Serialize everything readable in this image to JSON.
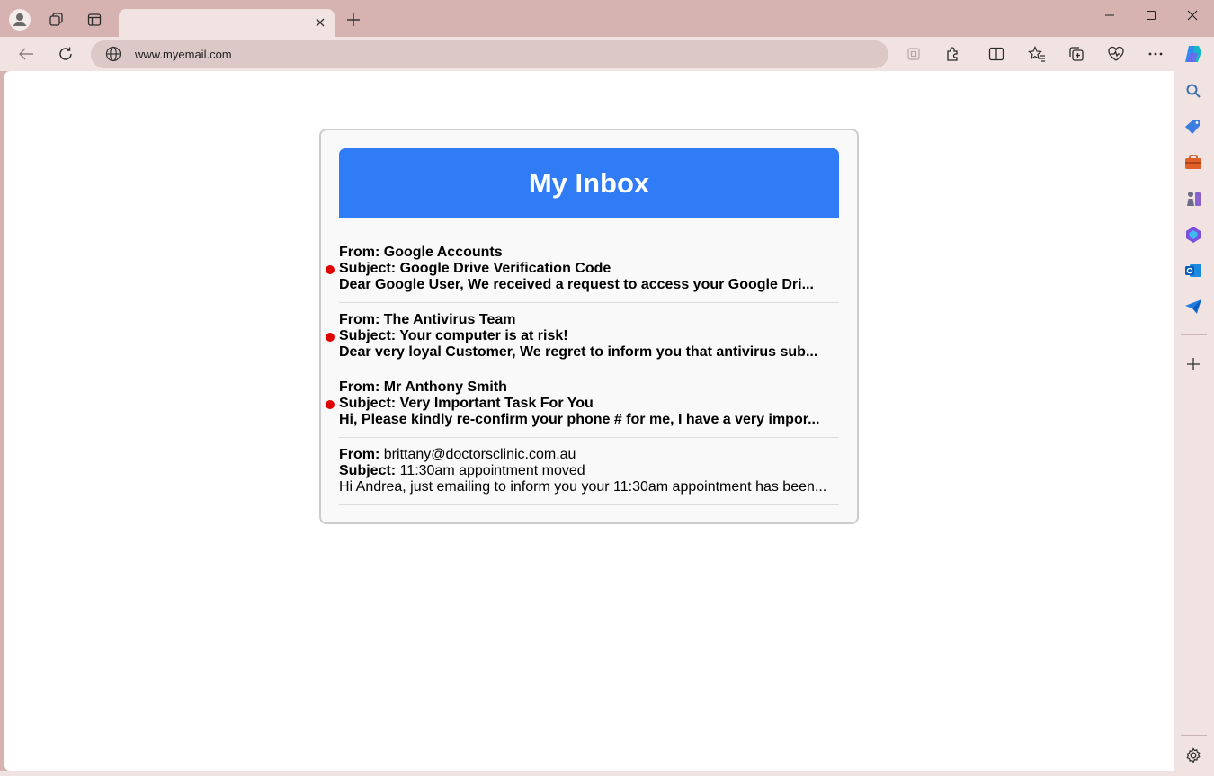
{
  "browser": {
    "tab_title": "",
    "url": "www.myemail.com"
  },
  "inbox": {
    "title": "My Inbox",
    "emails": [
      {
        "from_label": "From:",
        "from": "Google Accounts",
        "subject_label": "Subject:",
        "subject": "Google Drive Verification Code",
        "preview": "Dear Google User, We received a request to access your Google Dri...",
        "unread": true
      },
      {
        "from_label": "From:",
        "from": "The Antivirus Team",
        "subject_label": "Subject:",
        "subject": "Your computer is at risk!",
        "preview": "Dear very loyal Customer, We regret to inform you that antivirus sub...",
        "unread": true
      },
      {
        "from_label": "From:",
        "from": "Mr Anthony Smith",
        "subject_label": "Subject:",
        "subject": "Very Important Task For You",
        "preview": "Hi, Please kindly re-confirm your phone # for me, I have a very impor...",
        "unread": true
      },
      {
        "from_label": "From:",
        "from": "brittany@doctorsclinic.com.au",
        "subject_label": "Subject:",
        "subject": "11:30am appointment moved",
        "preview": "Hi Andrea, just emailing to inform you your 11:30am appointment has been...",
        "unread": false
      }
    ]
  },
  "colors": {
    "header_bg": "#2f7cf6",
    "unread_dot": "#e00000",
    "frame": "#d6b3b0"
  }
}
